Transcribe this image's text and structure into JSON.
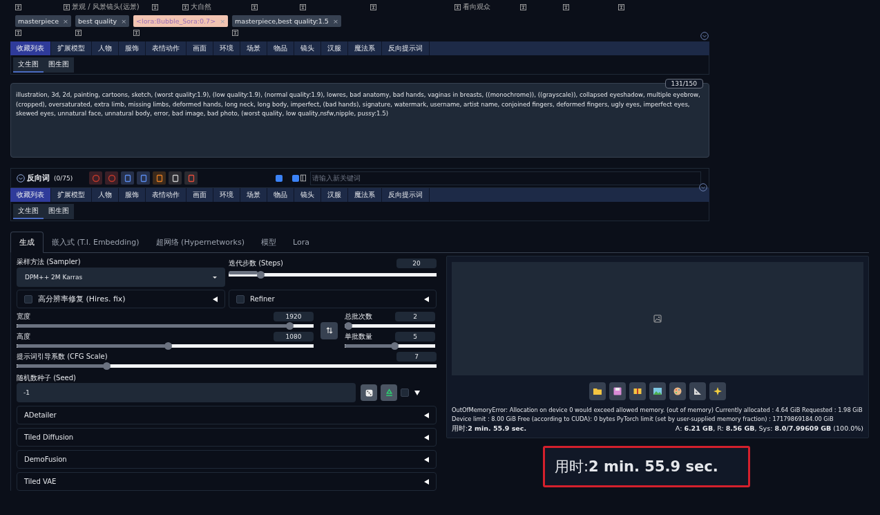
{
  "top_tags": [
    {
      "label": "景观 / 风景镜头(远景)"
    },
    {
      "label": "大自然"
    },
    {
      "label": "看向观众"
    }
  ],
  "prompt_tags": [
    {
      "text": "masterpiece",
      "kind": "normal",
      "remove": "×"
    },
    {
      "text": "best quality",
      "kind": "normal",
      "remove": "×"
    },
    {
      "text": "<lora:Bubble_Sora:0.7>",
      "kind": "lora",
      "remove": "×"
    },
    {
      "text": "masterpiece,best quality:1.5",
      "kind": "normal",
      "remove": "×"
    }
  ],
  "category_tabs": [
    {
      "label": "收藏列表",
      "selected": true
    },
    {
      "label": "扩展模型",
      "selected": false
    },
    {
      "label": "人物",
      "selected": false
    },
    {
      "label": "服饰",
      "selected": false
    },
    {
      "label": "表情动作",
      "selected": false
    },
    {
      "label": "画面",
      "selected": false
    },
    {
      "label": "环境",
      "selected": false
    },
    {
      "label": "场景",
      "selected": false
    },
    {
      "label": "物品",
      "selected": false
    },
    {
      "label": "镜头",
      "selected": false
    },
    {
      "label": "汉服",
      "selected": false
    },
    {
      "label": "魔法系",
      "selected": false
    },
    {
      "label": "反向提示词",
      "selected": false
    }
  ],
  "sub_tabs": [
    {
      "label": "文生图",
      "selected": true
    },
    {
      "label": "图生图",
      "selected": false
    }
  ],
  "negative_prompt": {
    "counter": "131/150",
    "text": "illustration, 3d, 2d, painting, cartoons, sketch, (worst quality:1.9), (low quality:1.9), (normal quality:1.9), lowres, bad anatomy, bad hands, vaginas in breasts, ((monochrome)), ((grayscale)), collapsed eyeshadow, multiple eyebrow, (cropped), oversaturated, extra limb, missing limbs, deformed hands, long neck, long body, imperfect, (bad hands), signature, watermark, username, artist name, conjoined fingers, deformed fingers, ugly eyes, imperfect eyes, skewed eyes, unnatural face, unnatural body, error, bad image, bad photo, (worst quality, low quality,nsfw,nipple, pussy:1.5)"
  },
  "negative_bar": {
    "title": "反向词",
    "count": "(0/75)",
    "checkbox_1": {
      "checked": true
    },
    "checkbox_2": {
      "checked": true
    },
    "placeholder": "请输入新关键词"
  },
  "category_tabs_2": [
    {
      "label": "收藏列表",
      "selected": true
    },
    {
      "label": "扩展模型",
      "selected": false
    },
    {
      "label": "人物",
      "selected": false
    },
    {
      "label": "服饰",
      "selected": false
    },
    {
      "label": "表情动作",
      "selected": false
    },
    {
      "label": "画面",
      "selected": false
    },
    {
      "label": "环境",
      "selected": false
    },
    {
      "label": "场景",
      "selected": false
    },
    {
      "label": "物品",
      "selected": false
    },
    {
      "label": "镜头",
      "selected": false
    },
    {
      "label": "汉服",
      "selected": false
    },
    {
      "label": "魔法系",
      "selected": false
    },
    {
      "label": "反向提示词",
      "selected": false
    }
  ],
  "sub_tabs_2": [
    {
      "label": "文生图",
      "selected": true
    },
    {
      "label": "图生图",
      "selected": false
    }
  ],
  "main_tabs": [
    {
      "label": "生成",
      "selected": true
    },
    {
      "label": "嵌入式 (T.I. Embedding)",
      "selected": false
    },
    {
      "label": "超网络 (Hypernetworks)",
      "selected": false
    },
    {
      "label": "模型",
      "selected": false
    },
    {
      "label": "Lora",
      "selected": false
    }
  ],
  "sampler": {
    "label": "采样方法 (Sampler)",
    "value": "DPM++ 2M Karras"
  },
  "steps": {
    "label": "迭代步数 (Steps)",
    "value": "20",
    "level": 0.14
  },
  "hires_fix": {
    "label": "高分辨率修复 (Hires. fix)",
    "checked": false
  },
  "refiner": {
    "label": "Refiner",
    "checked": false
  },
  "width": {
    "label": "宽度",
    "value": "1920",
    "level": 0.93
  },
  "height": {
    "label": "高度",
    "value": "1080",
    "level": 0.51
  },
  "batch_count": {
    "label": "总批次数",
    "value": "2",
    "level": 0.0
  },
  "batch_size": {
    "label": "单批数量",
    "value": "5",
    "level": 0.56
  },
  "cfg_scale": {
    "label": "提示词引导系数 (CFG Scale)",
    "value": "7",
    "level": 0.21
  },
  "seed": {
    "label": "随机数种子 (Seed)",
    "value": "-1",
    "extra_checked": false
  },
  "accordions": [
    {
      "label": "ADetailer"
    },
    {
      "label": "Tiled Diffusion"
    },
    {
      "label": "DemoFusion"
    },
    {
      "label": "Tiled VAE"
    }
  ],
  "output": {
    "error_lines": [
      "OutOfMemoryError: Allocation on device 0 would exceed allowed memory. (out of memory) Currently allocated : 4.64 GiB Requested : 1.98 GiB",
      "Device limit : 8.00 GiB Free (according to CUDA): 0 bytes PyTorch limit (set by user-supplied memory fraction) : 17179869184.00 GiB"
    ],
    "time": "用时:**2 min. 55.9 sec.**",
    "memory": "A: **6.21 GB**, R: **8.56 GB**, Sys: **8.0/7.99609 GB** (100.0%)"
  },
  "time_highlight": "用时:**2 min. 55.9 sec.**"
}
